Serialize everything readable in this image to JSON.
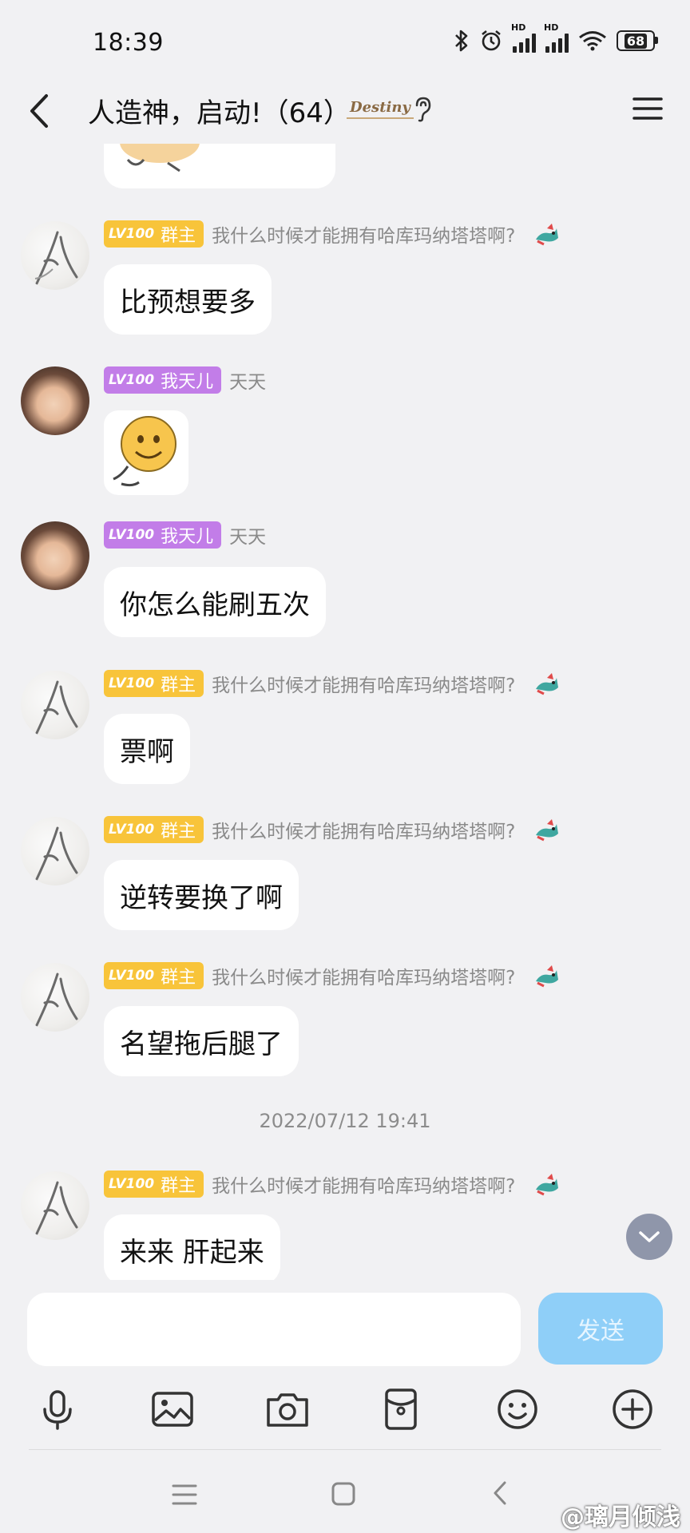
{
  "status_bar": {
    "time": "18:39",
    "battery": "68",
    "signal_label": "HD"
  },
  "header": {
    "title": "人造神，启动!（64）",
    "badge": "Destiny"
  },
  "tag": {
    "level": "LV100"
  },
  "messages": [
    {
      "sender_title": "群主",
      "nickname": "我什么时候才能拥有哈库玛纳塔塔啊?",
      "text": "比预想要多"
    },
    {
      "sender_title": "我天儿",
      "nickname": "天天",
      "text": ""
    },
    {
      "sender_title": "我天儿",
      "nickname": "天天",
      "text": "你怎么能刷五次"
    },
    {
      "sender_title": "群主",
      "nickname": "我什么时候才能拥有哈库玛纳塔塔啊?",
      "text": "票啊"
    },
    {
      "sender_title": "群主",
      "nickname": "我什么时候才能拥有哈库玛纳塔塔啊?",
      "text": "逆转要换了啊"
    },
    {
      "sender_title": "群主",
      "nickname": "我什么时候才能拥有哈库玛纳塔塔啊?",
      "text": "名望拖后腿了"
    },
    {
      "sender_title": "群主",
      "nickname": "我什么时候才能拥有哈库玛纳塔塔啊?",
      "text": "来来 肝起来"
    }
  ],
  "timestamp": "2022/07/12 19:41",
  "composer": {
    "send_label": "发送",
    "placeholder": ""
  },
  "watermark": "@璃月倾浅",
  "colors": {
    "accent": "#8fcff8",
    "owner_tag": "#f8c43a",
    "member_tag": "#c27de8"
  }
}
